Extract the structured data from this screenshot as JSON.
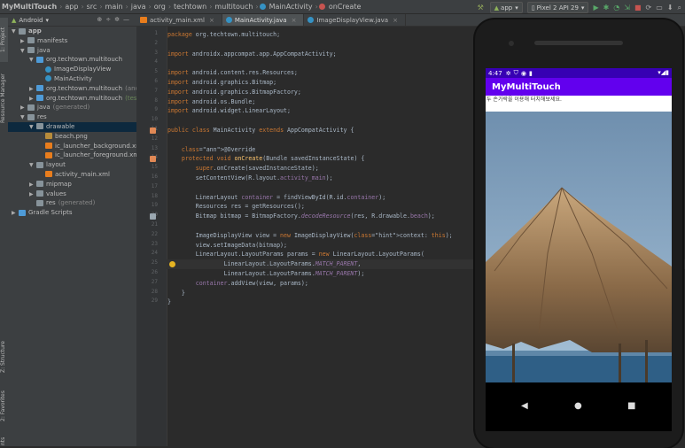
{
  "breadcrumb": {
    "items": [
      "MyMultiTouch",
      "app",
      "src",
      "main",
      "java",
      "org",
      "techtown",
      "multitouch",
      "MainActivity",
      "onCreate"
    ]
  },
  "toolbar": {
    "run_config": "app",
    "device": "Pixel 2 API 29"
  },
  "side_tabs": {
    "project": "1: Project",
    "resource_manager": "Resource Manager",
    "structure": "Z: Structure",
    "favorites": "2: Favorites",
    "build_variants": "nts"
  },
  "project_panel": {
    "view_mode": "Android",
    "tree": [
      {
        "label": "app",
        "depth": 0,
        "expanded": true,
        "icon": "folder-icon",
        "bold": true
      },
      {
        "label": "manifests",
        "depth": 1,
        "expanded": false,
        "icon": "folder-icon"
      },
      {
        "label": "java",
        "depth": 1,
        "expanded": true,
        "icon": "folder-icon"
      },
      {
        "label": "org.techtown.multitouch",
        "depth": 2,
        "expanded": true,
        "icon": "package-icon"
      },
      {
        "label": "ImageDisplayView",
        "depth": 3,
        "icon": "class-icon"
      },
      {
        "label": "MainActivity",
        "depth": 3,
        "icon": "class-icon"
      },
      {
        "label": "org.techtown.multitouch",
        "suffix": "(androidTest)",
        "depth": 2,
        "expanded": false,
        "icon": "package-icon"
      },
      {
        "label": "org.techtown.multitouch",
        "suffix": "(test)",
        "depth": 2,
        "expanded": false,
        "icon": "package-icon"
      },
      {
        "label": "java",
        "suffix": "(generated)",
        "depth": 1,
        "expanded": false,
        "icon": "folder-icon"
      },
      {
        "label": "res",
        "depth": 1,
        "expanded": true,
        "icon": "folder-icon"
      },
      {
        "label": "drawable",
        "depth": 2,
        "expanded": true,
        "icon": "folder-icon",
        "selected": true
      },
      {
        "label": "beach.png",
        "depth": 3,
        "icon": "image-icon"
      },
      {
        "label": "ic_launcher_background.xml",
        "depth": 3,
        "icon": "xml-icon"
      },
      {
        "label": "ic_launcher_foreground.xml",
        "suffix": "(v",
        "depth": 3,
        "icon": "xml-icon"
      },
      {
        "label": "layout",
        "depth": 2,
        "expanded": true,
        "icon": "folder-icon"
      },
      {
        "label": "activity_main.xml",
        "depth": 3,
        "icon": "xml-icon"
      },
      {
        "label": "mipmap",
        "depth": 2,
        "expanded": false,
        "icon": "folder-icon"
      },
      {
        "label": "values",
        "depth": 2,
        "expanded": false,
        "icon": "folder-icon"
      },
      {
        "label": "res",
        "suffix": "(generated)",
        "depth": 2,
        "icon": "folder-icon"
      },
      {
        "label": "Gradle Scripts",
        "depth": 0,
        "expanded": false,
        "icon": "gradle-icon"
      }
    ]
  },
  "editor_tabs": [
    {
      "label": "activity_main.xml",
      "active": false
    },
    {
      "label": "MainActivity.java",
      "active": true
    },
    {
      "label": "ImageDisplayView.java",
      "active": false
    }
  ],
  "code_lines": [
    "package org.techtown.multitouch;",
    "",
    "import androidx.appcompat.app.AppCompatActivity;",
    "",
    "import android.content.res.Resources;",
    "import android.graphics.Bitmap;",
    "import android.graphics.BitmapFactory;",
    "import android.os.Bundle;",
    "import android.widget.LinearLayout;",
    "",
    "public class MainActivity extends AppCompatActivity {",
    "",
    "    @Override",
    "    protected void onCreate(Bundle savedInstanceState) {",
    "        super.onCreate(savedInstanceState);",
    "        setContentView(R.layout.activity_main);",
    "",
    "        LinearLayout container = findViewById(R.id.container);",
    "        Resources res = getResources();",
    "        Bitmap bitmap = BitmapFactory.decodeResource(res, R.drawable.beach);",
    "",
    "        ImageDisplayView view = new ImageDisplayView( context: this);",
    "        view.setImageData(bitmap);",
    "        LinearLayout.LayoutParams params = new LinearLayout.LayoutParams(",
    "                LinearLayout.LayoutParams.MATCH_PARENT,",
    "                LinearLayout.LayoutParams.MATCH_PARENT);",
    "        container.addView(view, params);",
    "    }",
    "}"
  ],
  "current_line": 25,
  "emulator": {
    "time": "4:47",
    "app_title": "MyMultiTouch",
    "hint_text": "두 손가락을 이용해 터치해보세요.",
    "colors": {
      "status_bar": "#3700b3",
      "app_bar": "#6200ee"
    }
  }
}
